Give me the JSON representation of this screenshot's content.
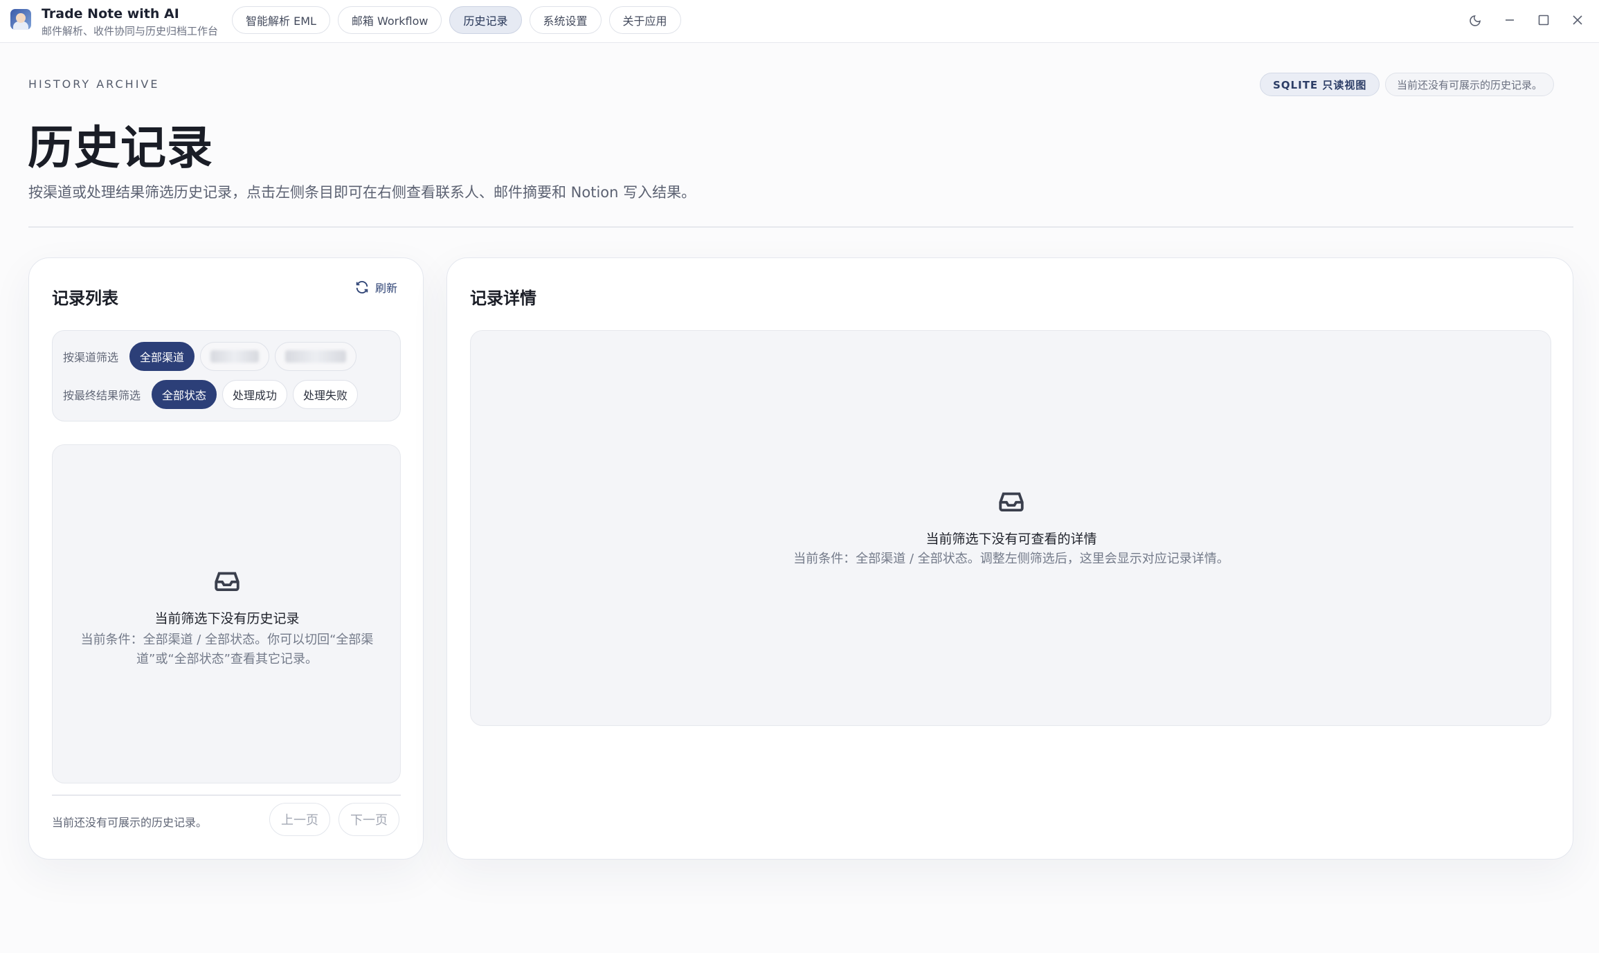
{
  "app": {
    "title": "Trade Note with AI",
    "subtitle": "邮件解析、收件协同与历史归档工作台"
  },
  "nav": {
    "tabs": [
      {
        "label": "智能解析 EML",
        "active": false
      },
      {
        "label": "邮箱 Workflow",
        "active": false
      },
      {
        "label": "历史记录",
        "active": true
      },
      {
        "label": "系统设置",
        "active": false
      },
      {
        "label": "关于应用",
        "active": false
      }
    ]
  },
  "window_controls": [
    "theme-toggle-icon",
    "minimize-icon",
    "maximize-icon",
    "close-icon"
  ],
  "header": {
    "eyebrow": "HISTORY ARCHIVE",
    "title": "历史记录",
    "description": "按渠道或处理结果筛选历史记录，点击左侧条目即可在右侧查看联系人、邮件摘要和 Notion 写入结果。",
    "badge_mode": "SQLITE 只读视图",
    "badge_status": "当前还没有可展示的历史记录。"
  },
  "list_panel": {
    "title": "记录列表",
    "refresh_label": "刷新",
    "channel_filter_label": "按渠道筛选",
    "channel_options": [
      "全部渠道"
    ],
    "result_filter_label": "按最终结果筛选",
    "result_options": [
      "全部状态",
      "处理成功",
      "处理失败"
    ],
    "empty_title": "当前筛选下没有历史记录",
    "empty_desc": "当前条件：全部渠道 / 全部状态。你可以切回“全部渠道”或“全部状态”查看其它记录。",
    "footer_text": "当前还没有可展示的历史记录。",
    "prev_label": "上一页",
    "next_label": "下一页"
  },
  "detail_panel": {
    "title": "记录详情",
    "empty_title": "当前筛选下没有可查看的详情",
    "empty_desc": "当前条件：全部渠道 / 全部状态。调整左侧筛选后，这里会显示对应记录详情。"
  },
  "colors": {
    "accent": "#2c3f78",
    "background": "#fbfbfc",
    "panel": "#f4f5f8"
  }
}
